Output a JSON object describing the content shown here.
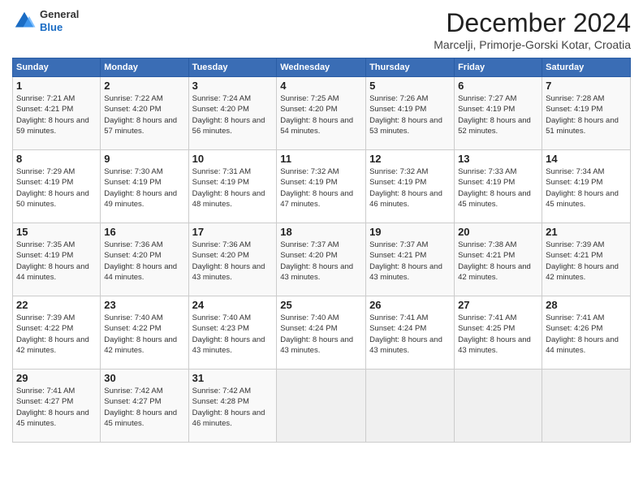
{
  "logo": {
    "general": "General",
    "blue": "Blue"
  },
  "title": "December 2024",
  "subtitle": "Marcelji, Primorje-Gorski Kotar, Croatia",
  "days_of_week": [
    "Sunday",
    "Monday",
    "Tuesday",
    "Wednesday",
    "Thursday",
    "Friday",
    "Saturday"
  ],
  "weeks": [
    [
      {
        "day": "1",
        "sunrise": "7:21 AM",
        "sunset": "4:21 PM",
        "daylight": "8 hours and 59 minutes."
      },
      {
        "day": "2",
        "sunrise": "7:22 AM",
        "sunset": "4:20 PM",
        "daylight": "8 hours and 57 minutes."
      },
      {
        "day": "3",
        "sunrise": "7:24 AM",
        "sunset": "4:20 PM",
        "daylight": "8 hours and 56 minutes."
      },
      {
        "day": "4",
        "sunrise": "7:25 AM",
        "sunset": "4:20 PM",
        "daylight": "8 hours and 54 minutes."
      },
      {
        "day": "5",
        "sunrise": "7:26 AM",
        "sunset": "4:19 PM",
        "daylight": "8 hours and 53 minutes."
      },
      {
        "day": "6",
        "sunrise": "7:27 AM",
        "sunset": "4:19 PM",
        "daylight": "8 hours and 52 minutes."
      },
      {
        "day": "7",
        "sunrise": "7:28 AM",
        "sunset": "4:19 PM",
        "daylight": "8 hours and 51 minutes."
      }
    ],
    [
      {
        "day": "8",
        "sunrise": "7:29 AM",
        "sunset": "4:19 PM",
        "daylight": "8 hours and 50 minutes."
      },
      {
        "day": "9",
        "sunrise": "7:30 AM",
        "sunset": "4:19 PM",
        "daylight": "8 hours and 49 minutes."
      },
      {
        "day": "10",
        "sunrise": "7:31 AM",
        "sunset": "4:19 PM",
        "daylight": "8 hours and 48 minutes."
      },
      {
        "day": "11",
        "sunrise": "7:32 AM",
        "sunset": "4:19 PM",
        "daylight": "8 hours and 47 minutes."
      },
      {
        "day": "12",
        "sunrise": "7:32 AM",
        "sunset": "4:19 PM",
        "daylight": "8 hours and 46 minutes."
      },
      {
        "day": "13",
        "sunrise": "7:33 AM",
        "sunset": "4:19 PM",
        "daylight": "8 hours and 45 minutes."
      },
      {
        "day": "14",
        "sunrise": "7:34 AM",
        "sunset": "4:19 PM",
        "daylight": "8 hours and 45 minutes."
      }
    ],
    [
      {
        "day": "15",
        "sunrise": "7:35 AM",
        "sunset": "4:19 PM",
        "daylight": "8 hours and 44 minutes."
      },
      {
        "day": "16",
        "sunrise": "7:36 AM",
        "sunset": "4:20 PM",
        "daylight": "8 hours and 44 minutes."
      },
      {
        "day": "17",
        "sunrise": "7:36 AM",
        "sunset": "4:20 PM",
        "daylight": "8 hours and 43 minutes."
      },
      {
        "day": "18",
        "sunrise": "7:37 AM",
        "sunset": "4:20 PM",
        "daylight": "8 hours and 43 minutes."
      },
      {
        "day": "19",
        "sunrise": "7:37 AM",
        "sunset": "4:21 PM",
        "daylight": "8 hours and 43 minutes."
      },
      {
        "day": "20",
        "sunrise": "7:38 AM",
        "sunset": "4:21 PM",
        "daylight": "8 hours and 42 minutes."
      },
      {
        "day": "21",
        "sunrise": "7:39 AM",
        "sunset": "4:21 PM",
        "daylight": "8 hours and 42 minutes."
      }
    ],
    [
      {
        "day": "22",
        "sunrise": "7:39 AM",
        "sunset": "4:22 PM",
        "daylight": "8 hours and 42 minutes."
      },
      {
        "day": "23",
        "sunrise": "7:40 AM",
        "sunset": "4:22 PM",
        "daylight": "8 hours and 42 minutes."
      },
      {
        "day": "24",
        "sunrise": "7:40 AM",
        "sunset": "4:23 PM",
        "daylight": "8 hours and 43 minutes."
      },
      {
        "day": "25",
        "sunrise": "7:40 AM",
        "sunset": "4:24 PM",
        "daylight": "8 hours and 43 minutes."
      },
      {
        "day": "26",
        "sunrise": "7:41 AM",
        "sunset": "4:24 PM",
        "daylight": "8 hours and 43 minutes."
      },
      {
        "day": "27",
        "sunrise": "7:41 AM",
        "sunset": "4:25 PM",
        "daylight": "8 hours and 43 minutes."
      },
      {
        "day": "28",
        "sunrise": "7:41 AM",
        "sunset": "4:26 PM",
        "daylight": "8 hours and 44 minutes."
      }
    ],
    [
      {
        "day": "29",
        "sunrise": "7:41 AM",
        "sunset": "4:27 PM",
        "daylight": "8 hours and 45 minutes."
      },
      {
        "day": "30",
        "sunrise": "7:42 AM",
        "sunset": "4:27 PM",
        "daylight": "8 hours and 45 minutes."
      },
      {
        "day": "31",
        "sunrise": "7:42 AM",
        "sunset": "4:28 PM",
        "daylight": "8 hours and 46 minutes."
      },
      null,
      null,
      null,
      null
    ]
  ],
  "labels": {
    "sunrise": "Sunrise:",
    "sunset": "Sunset:",
    "daylight": "Daylight:"
  }
}
